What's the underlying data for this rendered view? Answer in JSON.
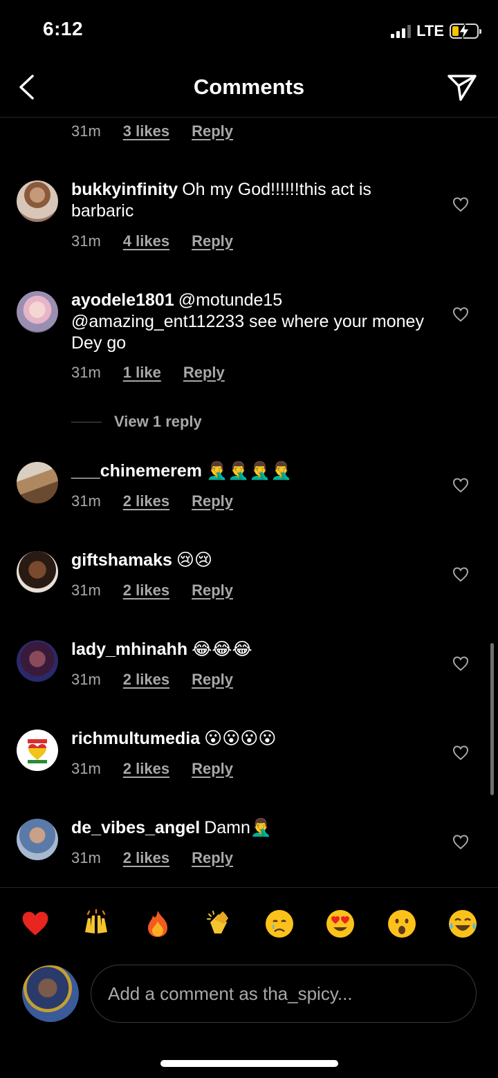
{
  "status_bar": {
    "time": "6:12",
    "network": "LTE"
  },
  "header": {
    "title": "Comments"
  },
  "top_partial": {
    "time": "31m",
    "likes": "3 likes",
    "reply": "Reply"
  },
  "comments": [
    {
      "username": "bukkyinfinity",
      "text": "Oh my God!!!!!!this act is barbaric",
      "time": "31m",
      "likes": "4 likes",
      "reply": "Reply"
    },
    {
      "username": "ayodele1801",
      "text": "@motunde15 @amazing_ent112233 see where your money Dey go",
      "time": "31m",
      "likes": "1 like",
      "reply": "Reply",
      "view_replies": "View 1 reply"
    },
    {
      "username": "___chinemerem",
      "text": "🤦‍♂️🤦‍♂️🤦‍♂️🤦‍♂️",
      "time": "31m",
      "likes": "2 likes",
      "reply": "Reply"
    },
    {
      "username": "giftshamaks",
      "text": "😢😢",
      "time": "31m",
      "likes": "2 likes",
      "reply": "Reply"
    },
    {
      "username": "lady_mhinahh",
      "text": "😂😂😂",
      "time": "31m",
      "likes": "2 likes",
      "reply": "Reply"
    },
    {
      "username": "richmultumedia",
      "text": "😮😮😮😮",
      "time": "31m",
      "likes": "2 likes",
      "reply": "Reply"
    },
    {
      "username": "de_vibes_angel",
      "text": "Damn🤦‍♂️",
      "time": "31m",
      "likes": "2 likes",
      "reply": "Reply"
    }
  ],
  "quick_reactions": [
    "❤️",
    "🙌",
    "🔥",
    "👏",
    "😢",
    "😍",
    "😮",
    "😂"
  ],
  "composer": {
    "placeholder": "Add a comment as tha_spicy..."
  },
  "colors": {
    "background": "#000000",
    "secondary_text": "#a8a8a8",
    "divider": "#262626"
  }
}
